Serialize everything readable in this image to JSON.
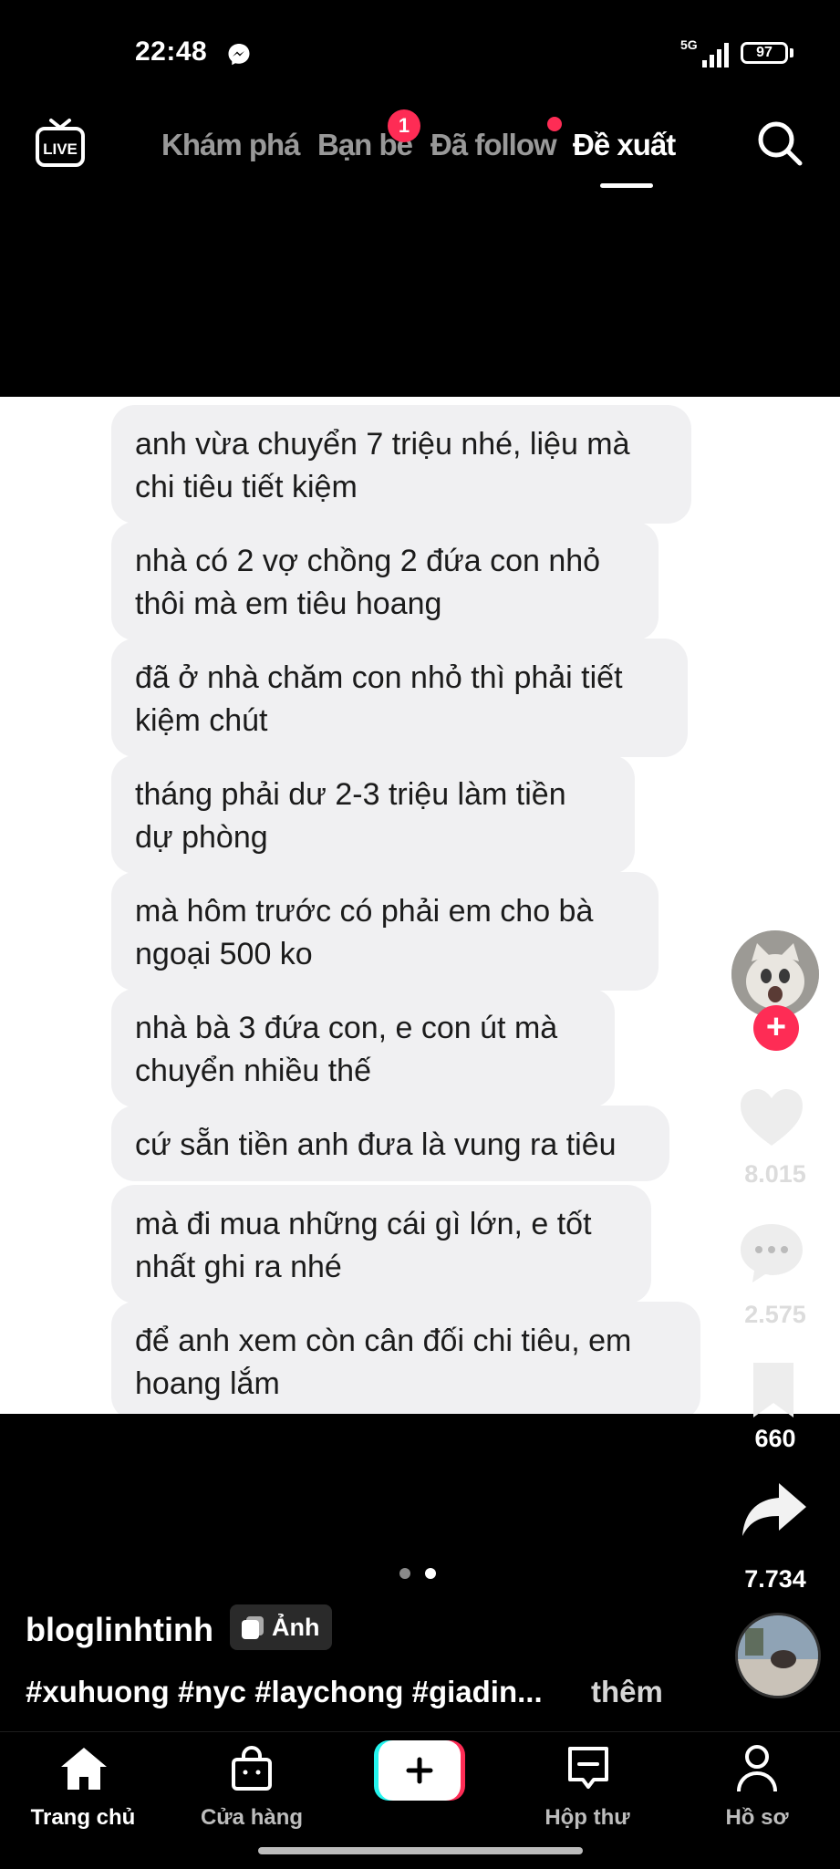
{
  "status_bar": {
    "time": "22:48",
    "network": "5G",
    "battery": "97"
  },
  "top_nav": {
    "tabs": [
      "Khám phá",
      "Bạn bè",
      "Đã follow",
      "Đề xuất"
    ],
    "active_tab": "Đề xuất",
    "friends_badge": "1"
  },
  "messages": [
    "anh vừa chuyển 7 triệu nhé, liệu mà chi tiêu tiết kiệm",
    "nhà có 2 vợ chồng 2 đứa con nhỏ thôi mà em tiêu hoang",
    "đã ở nhà chăm con nhỏ thì phải tiết kiệm chút",
    "tháng phải dư 2-3 triệu làm tiền dự phòng",
    "mà hôm trước có phải em cho bà ngoại 500 ko",
    "nhà bà 3 đứa con, e con út mà chuyển nhiều thế",
    "cứ sẵn tiền anh đưa là vung ra tiêu",
    "mà đi mua những cái gì lớn, e tốt nhất ghi ra nhé",
    "để anh xem còn cân đối chi tiêu, em hoang lắm"
  ],
  "actions": {
    "likes": "8.015",
    "comments": "2.575",
    "saves": "660",
    "shares": "7.734"
  },
  "caption": {
    "username": "bloglinhtinh",
    "photo_label": "Ảnh",
    "hashtags": "#xuhuong #nyc #laychong #giadin...",
    "more": "thêm"
  },
  "bottom_nav": {
    "home": "Trang chủ",
    "shop": "Cửa hàng",
    "inbox": "Hộp thư",
    "profile": "Hồ sơ"
  },
  "colors": {
    "accent": "#fe2c55",
    "background": "#000000",
    "bubble": "#f0f0f2",
    "cyan": "#25f4ee"
  }
}
